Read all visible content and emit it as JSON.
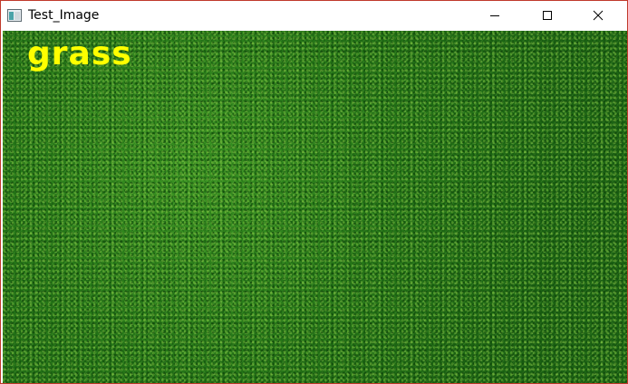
{
  "window": {
    "title": "Test_Image",
    "icon": "app-window-icon",
    "controls": {
      "minimize_icon": "minimize-icon",
      "maximize_icon": "maximize-icon",
      "close_icon": "close-icon"
    },
    "border_color": "#c0392b"
  },
  "image": {
    "label": "grass",
    "label_color": "#ffff00",
    "dominant_color": "#2e8a1e"
  }
}
